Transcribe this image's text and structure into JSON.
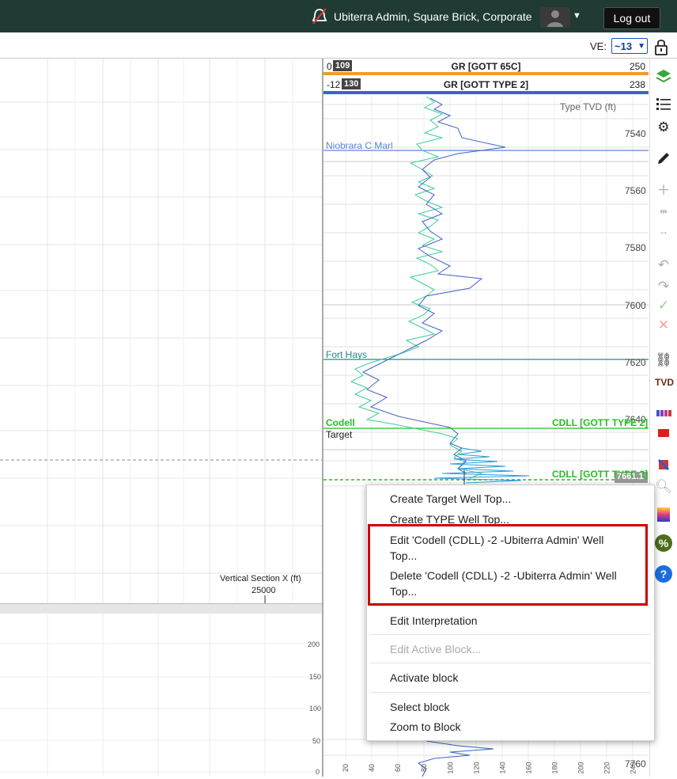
{
  "header": {
    "user": "Ubiterra Admin, Square Brick, Corporate",
    "logout": "Log out"
  },
  "subbar": {
    "ve_label": "VE:",
    "ve_value": "~13"
  },
  "logs": [
    {
      "min": "0",
      "badge": "109",
      "name": "GR [GOTT 65C]",
      "max": "250",
      "color": "#f29a2e"
    },
    {
      "min": "-12",
      "badge": "130",
      "name": "GR [GOTT TYPE 2]",
      "max": "238",
      "color": "#3a64c8"
    }
  ],
  "log_panel": {
    "depth_title": "Type TVD (ft)",
    "depths": [
      "7540",
      "7560",
      "7580",
      "7600",
      "7620",
      "7640"
    ],
    "bottom_depth": "7760",
    "tops": [
      {
        "label": "Niobrara C Marl",
        "color": "#5b86d6"
      },
      {
        "label": "Fort Hays",
        "color": "#1f8a8a"
      },
      {
        "label": "Codell",
        "color": "#22c022"
      },
      {
        "label": "Target",
        "color": "#222222"
      }
    ],
    "right_tops": [
      "CDLL [GOTT TYPE 2]",
      "CDLL [GOTT TYPE 2]"
    ],
    "cursor_depth": "7661.1",
    "bottom_axis": [
      "20",
      "40",
      "60",
      "80",
      "100",
      "120",
      "140",
      "160",
      "180",
      "200",
      "220",
      "240"
    ]
  },
  "section": {
    "axis_label": "Vertical Section X (ft)",
    "axis_value": "25000",
    "lower_ticks": [
      "200",
      "150",
      "100",
      "50",
      "0"
    ]
  },
  "context_menu": {
    "items": [
      {
        "label": "Create Target Well Top...",
        "enabled": true
      },
      {
        "label": "Create TYPE Well Top...",
        "enabled": true
      },
      {
        "label": "Edit 'Codell (CDLL) -2 -Ubiterra Admin' Well\nTop...",
        "enabled": true
      },
      {
        "label": "Delete 'Codell (CDLL) -2 -Ubiterra Admin' Well\nTop...",
        "enabled": true
      },
      {
        "label": "Edit Interpretation",
        "enabled": true
      },
      {
        "label": "Edit Active Block...",
        "enabled": false
      },
      {
        "label": "Activate block",
        "enabled": true
      },
      {
        "label": "Select block",
        "enabled": true
      },
      {
        "label": "Zoom to Block",
        "enabled": true
      }
    ]
  },
  "toolbar_icons": [
    "layers-icon",
    "list-icon",
    "gear-icon",
    "pencil-icon",
    "plus-icon",
    "split-icon",
    "expand-icon",
    "undo-icon",
    "redo-icon",
    "check-icon",
    "close-icon",
    "link-icon",
    "tvd-icon",
    "bars-icon",
    "red-rect-icon",
    "flag-icon",
    "zoom-icon",
    "gradient-icon",
    "percent-icon",
    "help-icon"
  ],
  "toolbar": {
    "tvd_label": "TVD",
    "percent_label": "%",
    "help_label": "?"
  }
}
